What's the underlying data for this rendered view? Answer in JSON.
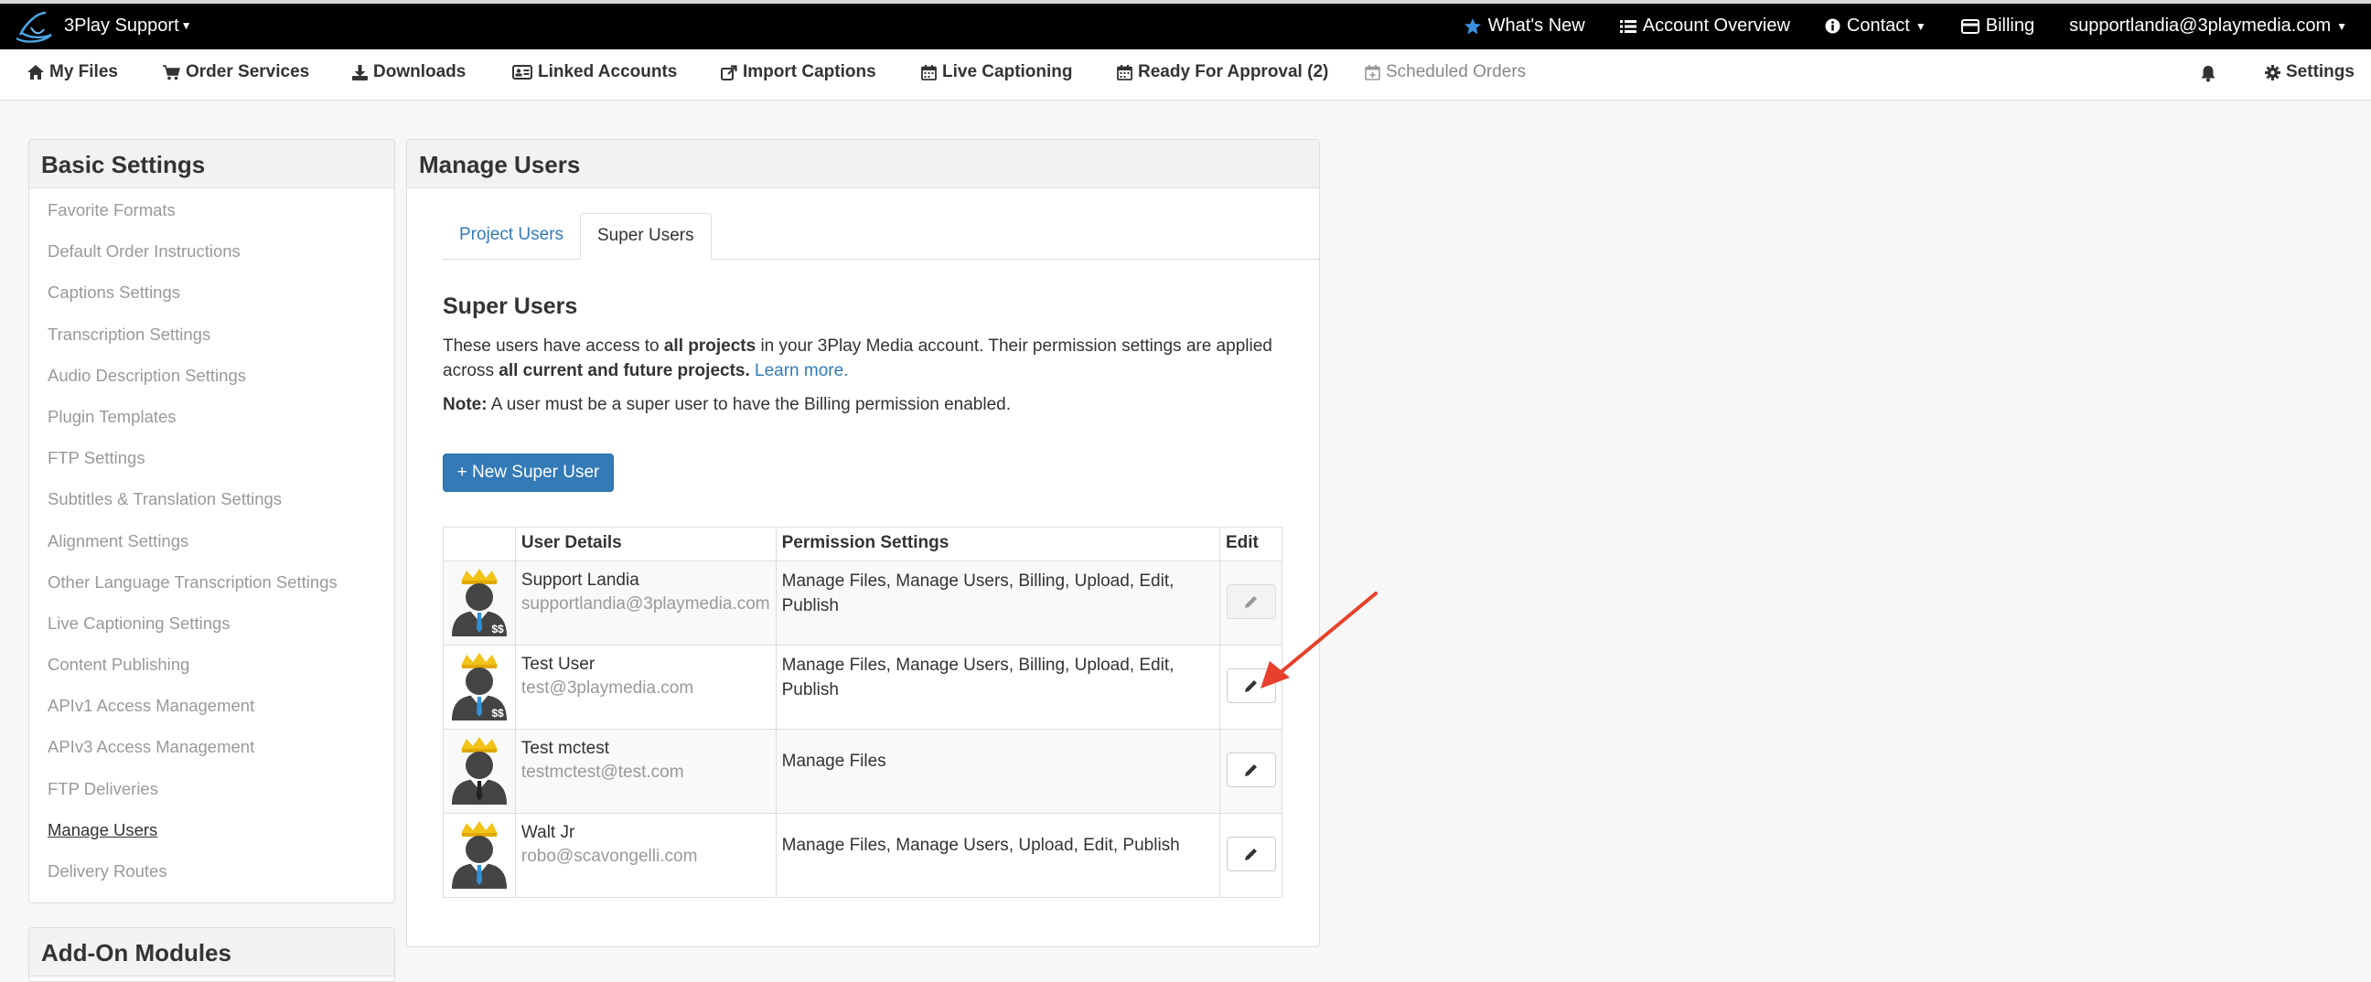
{
  "topbar": {
    "brand": "3Play Support",
    "whats_new": "What's New",
    "account_overview": "Account Overview",
    "contact": "Contact",
    "billing": "Billing",
    "user_email": "supportlandia@3playmedia.com"
  },
  "navbar": {
    "my_files": "My Files",
    "order_services": "Order Services",
    "downloads": "Downloads",
    "linked_accounts": "Linked Accounts",
    "import_captions": "Import Captions",
    "live_captioning": "Live Captioning",
    "ready_for_approval": "Ready For Approval (2)",
    "scheduled_orders": "Scheduled Orders",
    "settings": "Settings"
  },
  "sidebar": {
    "title": "Basic Settings",
    "items": [
      {
        "label": "Favorite Formats"
      },
      {
        "label": "Default Order Instructions"
      },
      {
        "label": "Captions Settings"
      },
      {
        "label": "Transcription Settings"
      },
      {
        "label": "Audio Description Settings"
      },
      {
        "label": "Plugin Templates"
      },
      {
        "label": "FTP Settings"
      },
      {
        "label": "Subtitles & Translation Settings"
      },
      {
        "label": "Alignment Settings"
      },
      {
        "label": "Other Language Transcription Settings"
      },
      {
        "label": "Live Captioning Settings"
      },
      {
        "label": "Content Publishing"
      },
      {
        "label": "APIv1 Access Management"
      },
      {
        "label": "APIv3 Access Management"
      },
      {
        "label": "FTP Deliveries"
      },
      {
        "label": "Manage Users",
        "active": true
      },
      {
        "label": "Delivery Routes"
      }
    ],
    "addon_title": "Add-On Modules"
  },
  "main": {
    "title": "Manage Users",
    "tabs": [
      {
        "label": "Project Users"
      },
      {
        "label": "Super Users"
      }
    ],
    "section_title": "Super Users",
    "desc": {
      "p1": "These users have access to ",
      "b1": "all projects",
      "p2": " in your 3Play Media account. Their permission settings are applied across ",
      "b2": "all current and future projects.",
      "link": "Learn more."
    },
    "note_label": "Note:",
    "note_text": " A user must be a super user to have the Billing permission enabled.",
    "new_button": "+ New Super User",
    "table": {
      "headers": [
        "",
        "User Details",
        "Permission Settings",
        "Edit"
      ],
      "rows": [
        {
          "name": "Support Landia",
          "email": "supportlandia@3playmedia.com",
          "permissions": "Manage Files, Manage Users, Billing, Upload, Edit, Publish",
          "billing_badge": "$$",
          "edit_disabled": true
        },
        {
          "name": "Test User",
          "email": "test@3playmedia.com",
          "permissions": "Manage Files, Manage Users, Billing, Upload, Edit, Publish",
          "billing_badge": "$$",
          "edit_disabled": false
        },
        {
          "name": "Test mctest",
          "email": "testmctest@test.com",
          "permissions": "Manage Files",
          "billing_badge": "",
          "edit_disabled": false
        },
        {
          "name": "Walt Jr",
          "email": "robo@scavongelli.com",
          "permissions": "Manage Files, Manage Users, Upload, Edit, Publish",
          "billing_badge": "",
          "edit_disabled": false
        }
      ]
    }
  },
  "colors": {
    "accent": "#337ab7",
    "arrow": "#e8402c",
    "crown": "#f2c318",
    "tie": "#2f8fd8"
  }
}
